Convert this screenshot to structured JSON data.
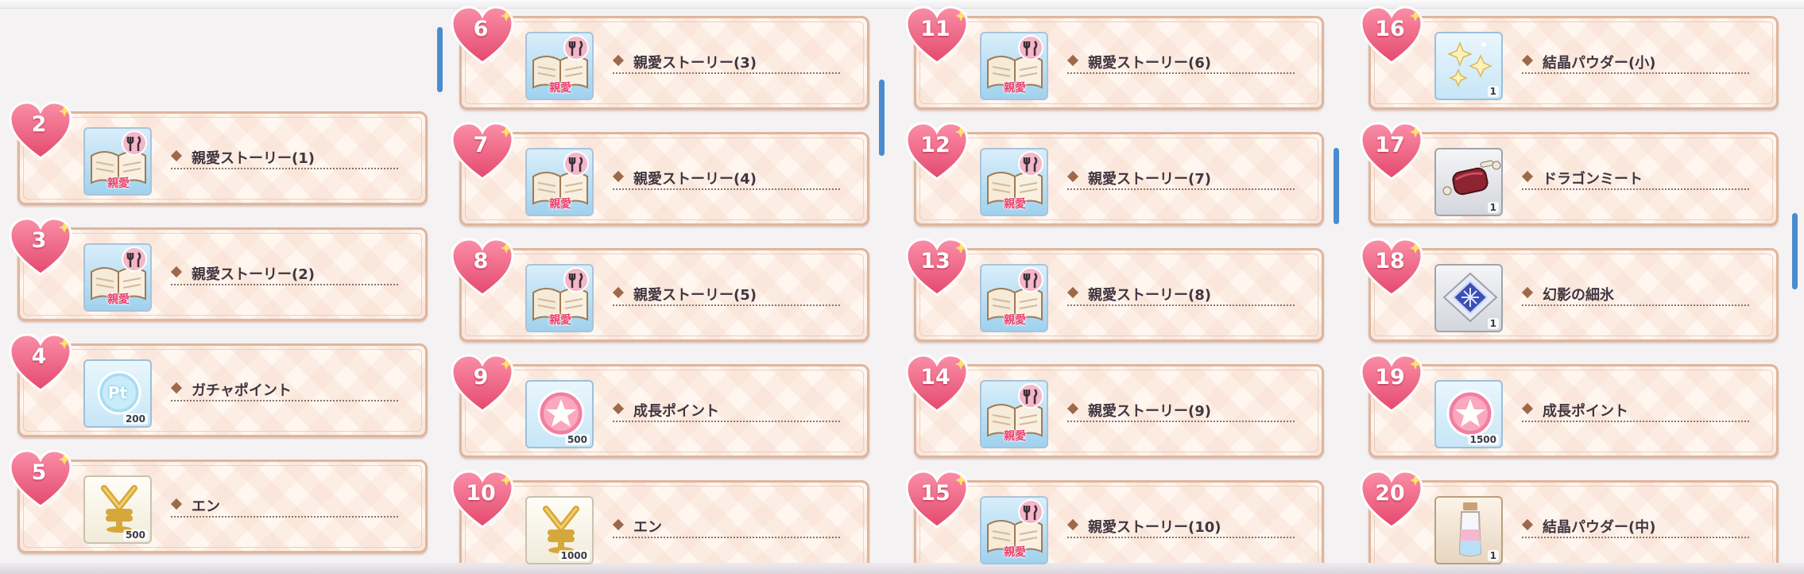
{
  "rewards": [
    {
      "level": "2",
      "name": "親愛ストーリー(1)",
      "icon": "love-story-book-icon",
      "badge": "親愛",
      "qty": ""
    },
    {
      "level": "3",
      "name": "親愛ストーリー(2)",
      "icon": "love-story-book-icon",
      "badge": "親愛",
      "qty": ""
    },
    {
      "level": "4",
      "name": "ガチャポイント",
      "icon": "gacha-point-icon",
      "badge": "Pt",
      "qty": "200"
    },
    {
      "level": "5",
      "name": "エン",
      "icon": "yen-icon",
      "badge": "",
      "qty": "500"
    },
    {
      "level": "6",
      "name": "親愛ストーリー(3)",
      "icon": "love-story-book-icon",
      "badge": "親愛",
      "qty": ""
    },
    {
      "level": "7",
      "name": "親愛ストーリー(4)",
      "icon": "love-story-book-icon",
      "badge": "親愛",
      "qty": ""
    },
    {
      "level": "8",
      "name": "親愛ストーリー(5)",
      "icon": "love-story-book-icon",
      "badge": "親愛",
      "qty": ""
    },
    {
      "level": "9",
      "name": "成長ポイント",
      "icon": "growth-point-icon",
      "badge": "",
      "qty": "500"
    },
    {
      "level": "10",
      "name": "エン",
      "icon": "yen-icon",
      "badge": "",
      "qty": "1000"
    },
    {
      "level": "11",
      "name": "親愛ストーリー(6)",
      "icon": "love-story-book-icon",
      "badge": "親愛",
      "qty": ""
    },
    {
      "level": "12",
      "name": "親愛ストーリー(7)",
      "icon": "love-story-book-icon",
      "badge": "親愛",
      "qty": ""
    },
    {
      "level": "13",
      "name": "親愛ストーリー(8)",
      "icon": "love-story-book-icon",
      "badge": "親愛",
      "qty": ""
    },
    {
      "level": "14",
      "name": "親愛ストーリー(9)",
      "icon": "love-story-book-icon",
      "badge": "親愛",
      "qty": ""
    },
    {
      "level": "15",
      "name": "親愛ストーリー(10)",
      "icon": "love-story-book-icon",
      "badge": "親愛",
      "qty": ""
    },
    {
      "level": "16",
      "name": "結晶パウダー(小)",
      "icon": "crystal-powder-icon",
      "badge": "",
      "qty": "1"
    },
    {
      "level": "17",
      "name": "ドラゴンミート",
      "icon": "dragon-meat-icon",
      "badge": "",
      "qty": "1"
    },
    {
      "level": "18",
      "name": "幻影の細氷",
      "icon": "phantom-ice-icon",
      "badge": "",
      "qty": "1"
    },
    {
      "level": "19",
      "name": "成長ポイント",
      "icon": "growth-point-icon",
      "badge": "",
      "qty": "1500"
    },
    {
      "level": "20",
      "name": "結晶パウダー(中)",
      "icon": "crystal-powder-bottle-icon",
      "badge": "",
      "qty": "1"
    }
  ],
  "colors": {
    "heart": "#f06a8a",
    "card_border": "#dfb59c",
    "card_bg": "#fff6ef",
    "scrollbar": "#4a8ccf",
    "label_text": "#403640"
  }
}
